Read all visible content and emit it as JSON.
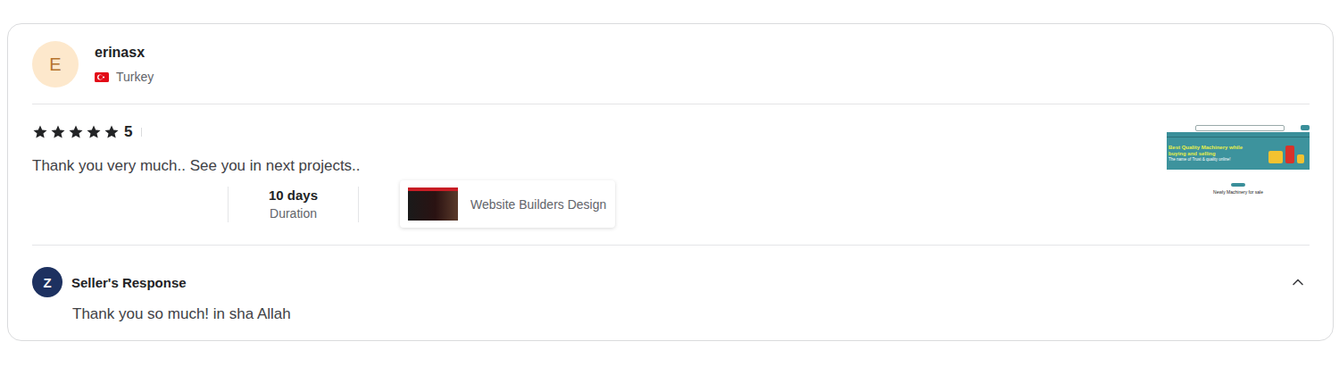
{
  "reviewer": {
    "initial": "E",
    "name": "erinasx",
    "country": "Turkey"
  },
  "review": {
    "stars": 5,
    "rating": "5",
    "text": "Thank you very much.. See you in next projects..",
    "duration": "10 days",
    "duration_label": "Duration",
    "gig_title": "Website Builders Design"
  },
  "attachment": {
    "headline": "Best Quality Machinery while buying and selling",
    "tagline": "The name of Trust & quality online!",
    "section": "Newly Machinery for sale"
  },
  "seller_response": {
    "initial": "Z",
    "title": "Seller's Response",
    "text": "Thank you so much! in sha Allah",
    "expanded": true
  }
}
